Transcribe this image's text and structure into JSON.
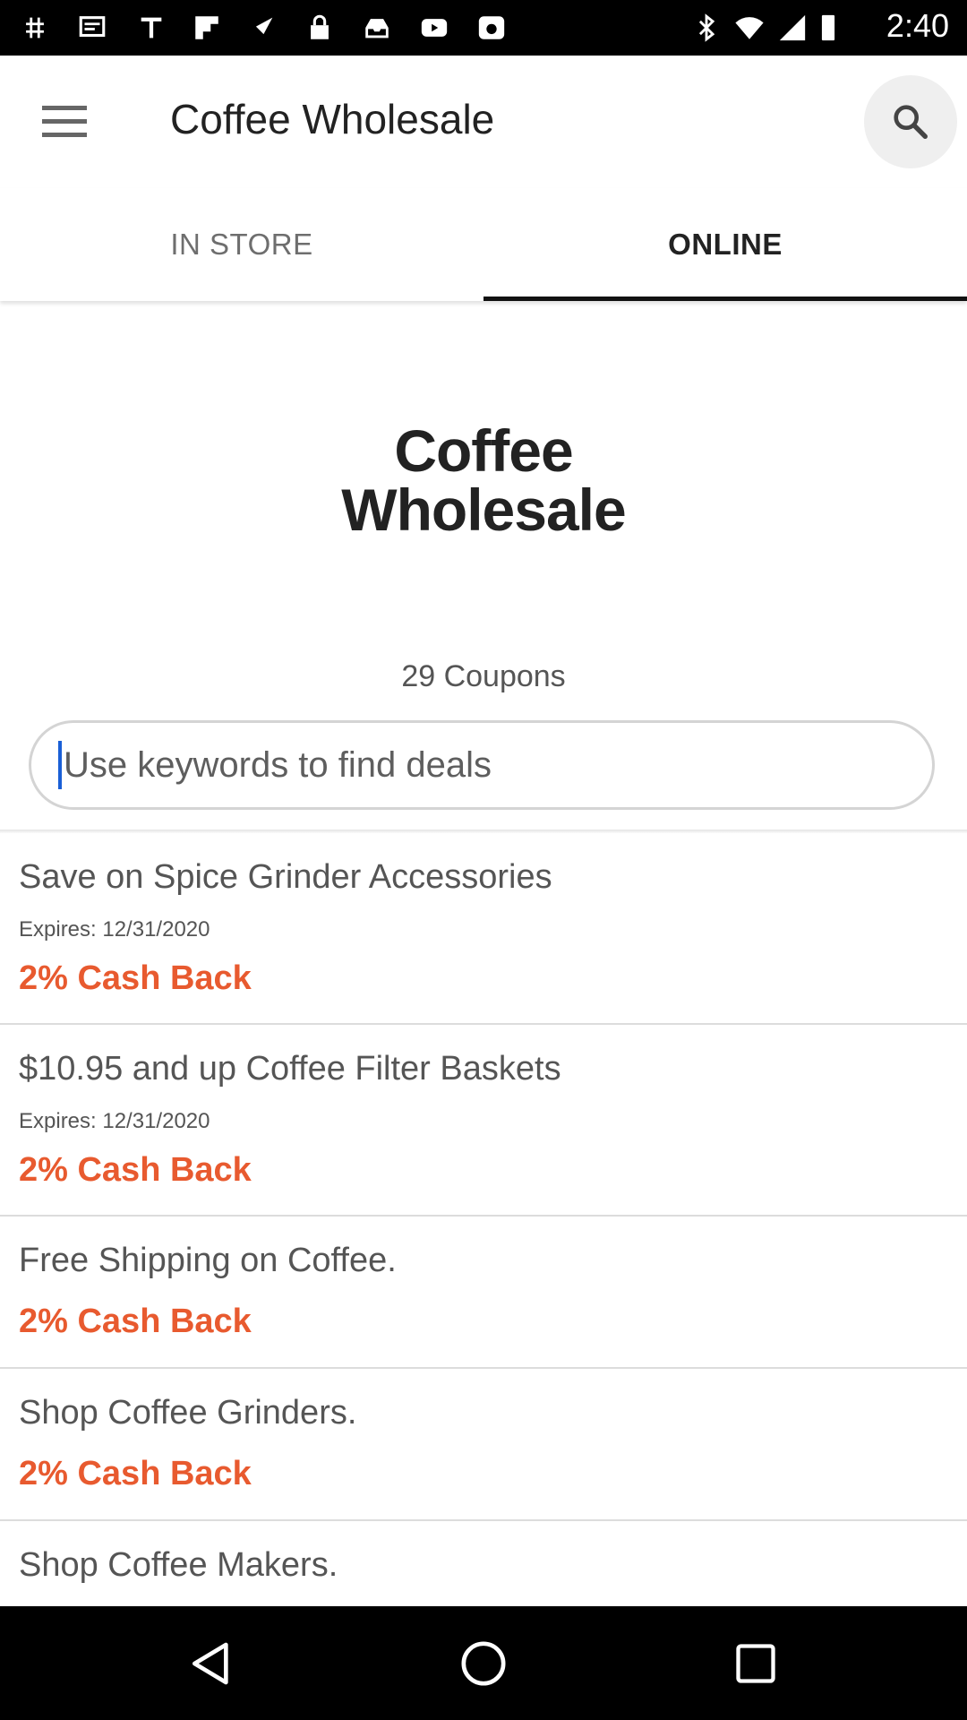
{
  "status_bar": {
    "time": "2:40",
    "icons": [
      "hashtag-icon",
      "message-icon",
      "text-icon",
      "flipboard-icon",
      "fake-gps-icon",
      "lock-icon",
      "inbox-icon",
      "youtube-icon",
      "camera-icon",
      "bluetooth-icon",
      "wifi-icon",
      "signal-icon",
      "battery-icon"
    ]
  },
  "app_bar": {
    "title": "Coffee Wholesale",
    "menu_icon": "hamburger-menu-icon",
    "search_icon": "search-icon"
  },
  "tabs": [
    {
      "label": "IN STORE",
      "selected": false
    },
    {
      "label": "ONLINE",
      "selected": true
    }
  ],
  "store": {
    "logo_line1": "Coffee",
    "logo_line2": "Wholesale",
    "coupon_count": "29 Coupons"
  },
  "search": {
    "placeholder": "Use keywords to find deals",
    "value": ""
  },
  "deals": [
    {
      "title": "Save on Spice Grinder Accessories",
      "expires": "Expires: 12/31/2020",
      "cashback": "2% Cash Back"
    },
    {
      "title": "$10.95 and up Coffee Filter Baskets",
      "expires": "Expires: 12/31/2020",
      "cashback": "2% Cash Back"
    },
    {
      "title": "Free Shipping on Coffee.",
      "expires": "",
      "cashback": "2% Cash Back"
    },
    {
      "title": "Shop Coffee Grinders.",
      "expires": "",
      "cashback": "2% Cash Back"
    },
    {
      "title": "Shop Coffee Makers.",
      "expires": "",
      "cashback": ""
    }
  ],
  "nav_bar": {
    "back_icon": "back-triangle-icon",
    "home_icon": "home-circle-icon",
    "recents_icon": "recents-square-icon"
  },
  "colors": {
    "cashback": "#e85a2f",
    "tab_indicator": "#111111",
    "search_bg": "#efefef",
    "caret": "#1a5fd6"
  }
}
